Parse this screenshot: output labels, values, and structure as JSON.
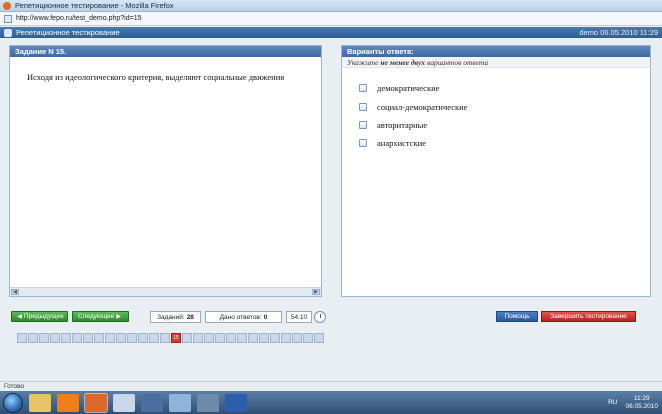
{
  "window": {
    "title": "Репетиционное тестирование - Mozilla Firefox",
    "url": "http://www.fepo.ru/test_demo.php?id=15"
  },
  "header": {
    "title": "Репетиционное тестирование",
    "user_info": "demo 06.05.2010 11:29"
  },
  "question": {
    "header": "Задание N 15.",
    "text": "Исходя из идеологического критерия, выделяют социальные движения"
  },
  "answers": {
    "header": "Варианты ответа:",
    "hint_prefix": "Укажите",
    "hint_bold": "не менее двух",
    "hint_suffix": "вариантов ответа",
    "options": [
      "демократические",
      "социал-демократические",
      "авторитарные",
      "анархистские"
    ]
  },
  "toolbar": {
    "prev_label": "Предыдущее",
    "next_label": "Следующее",
    "tasks_label": "Заданий:",
    "tasks_count": "28",
    "answered_label": "Дано ответов:",
    "answered_count": "0",
    "timer": "54:10",
    "help_label": "Помощь",
    "finish_label": "Завершить тестирование"
  },
  "nav": {
    "current": "15"
  },
  "status": {
    "text": "Готово"
  },
  "taskbar": {
    "lang": "RU",
    "time": "11:29",
    "date": "06.05.2010"
  },
  "colors": {
    "header_blue": "#2f5d95",
    "green_button": "#2f8a2f",
    "red_button": "#b52421",
    "current_question": "#d93a35"
  }
}
